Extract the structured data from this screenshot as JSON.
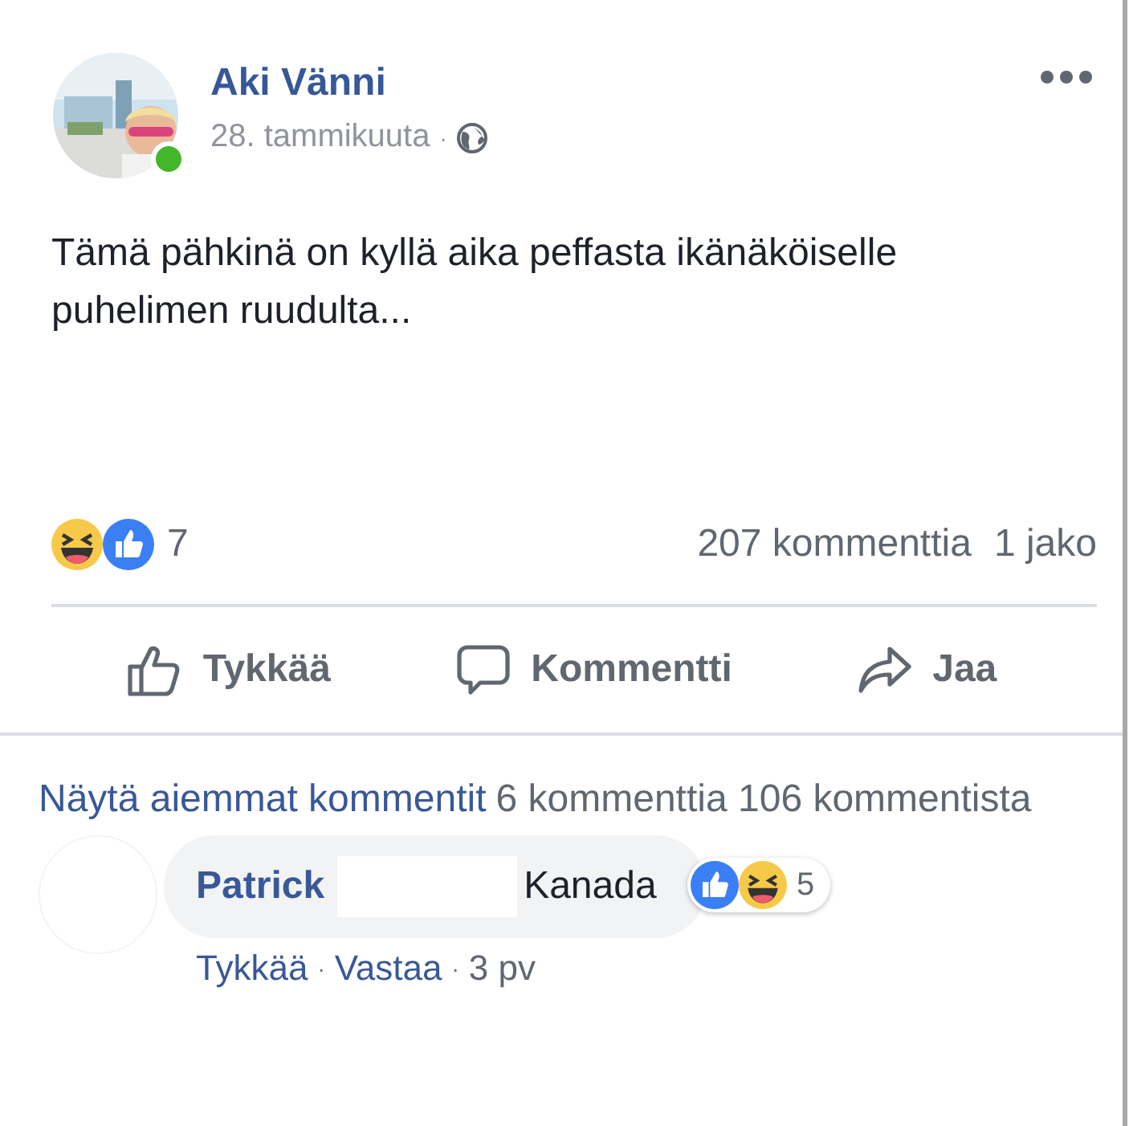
{
  "post": {
    "author": "Aki Vänni",
    "online": true,
    "date": "28. tammikuuta",
    "separator": "·",
    "text": "Tämä pähkinä on kyllä aika peffasta ikänäköiselle puhelimen ruudulta...",
    "reaction_count": "7",
    "comments_count": "207 kommenttia",
    "shares_count": "1 jako"
  },
  "actions": [
    {
      "kind": "like",
      "label": "Tykkää"
    },
    {
      "kind": "comment",
      "label": "Kommentti"
    },
    {
      "kind": "share",
      "label": "Jaa"
    }
  ],
  "comments_header": {
    "link": "Näytä aiemmat kommentit",
    "count": "6 kommenttia 106 kommentista"
  },
  "comments": [
    {
      "author": "Patrick",
      "text": "Kanada",
      "reaction_count": "5",
      "like": "Tykkää",
      "separator_1": "·",
      "reply": "Vastaa",
      "separator_2": "·",
      "age": "3 pv"
    }
  ]
}
